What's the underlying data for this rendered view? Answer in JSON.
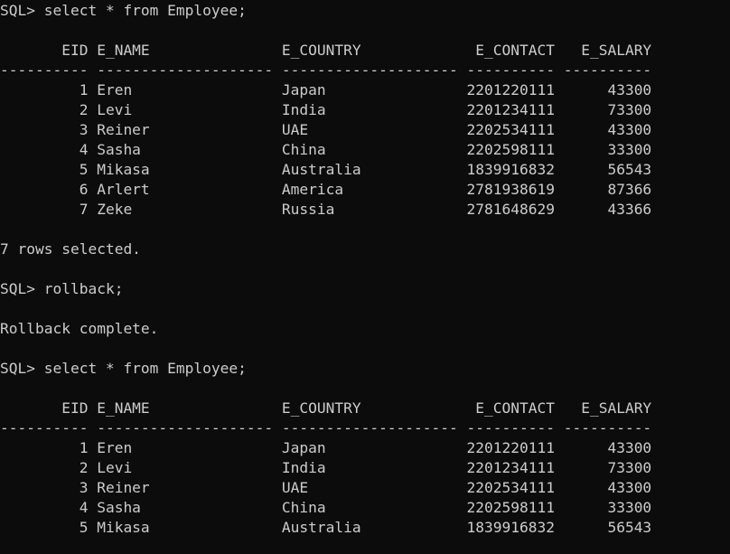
{
  "terminal": {
    "lines": [
      "SQL> select * from Employee;",
      "",
      "       EID E_NAME               E_COUNTRY             E_CONTACT   E_SALARY",
      "---------- -------------------- -------------------- ---------- ----------",
      "         1 Eren                 Japan                2201220111      43300",
      "         2 Levi                 India                2201234111      73300",
      "         3 Reiner               UAE                  2202534111      43300",
      "         4 Sasha                China                2202598111      33300",
      "         5 Mikasa               Australia            1839916832      56543",
      "         6 Arlert               America              2781938619      87366",
      "         7 Zeke                 Russia               2781648629      43366",
      "",
      "7 rows selected.",
      "",
      "SQL> rollback;",
      "",
      "Rollback complete.",
      "",
      "SQL> select * from Employee;",
      "",
      "       EID E_NAME               E_COUNTRY             E_CONTACT   E_SALARY",
      "---------- -------------------- -------------------- ---------- ----------",
      "         1 Eren                 Japan                2201220111      43300",
      "         2 Levi                 India                2201234111      73300",
      "         3 Reiner               UAE                  2202534111      43300",
      "         4 Sasha                China                2202598111      33300",
      "         5 Mikasa               Australia            1839916832      56543"
    ]
  }
}
